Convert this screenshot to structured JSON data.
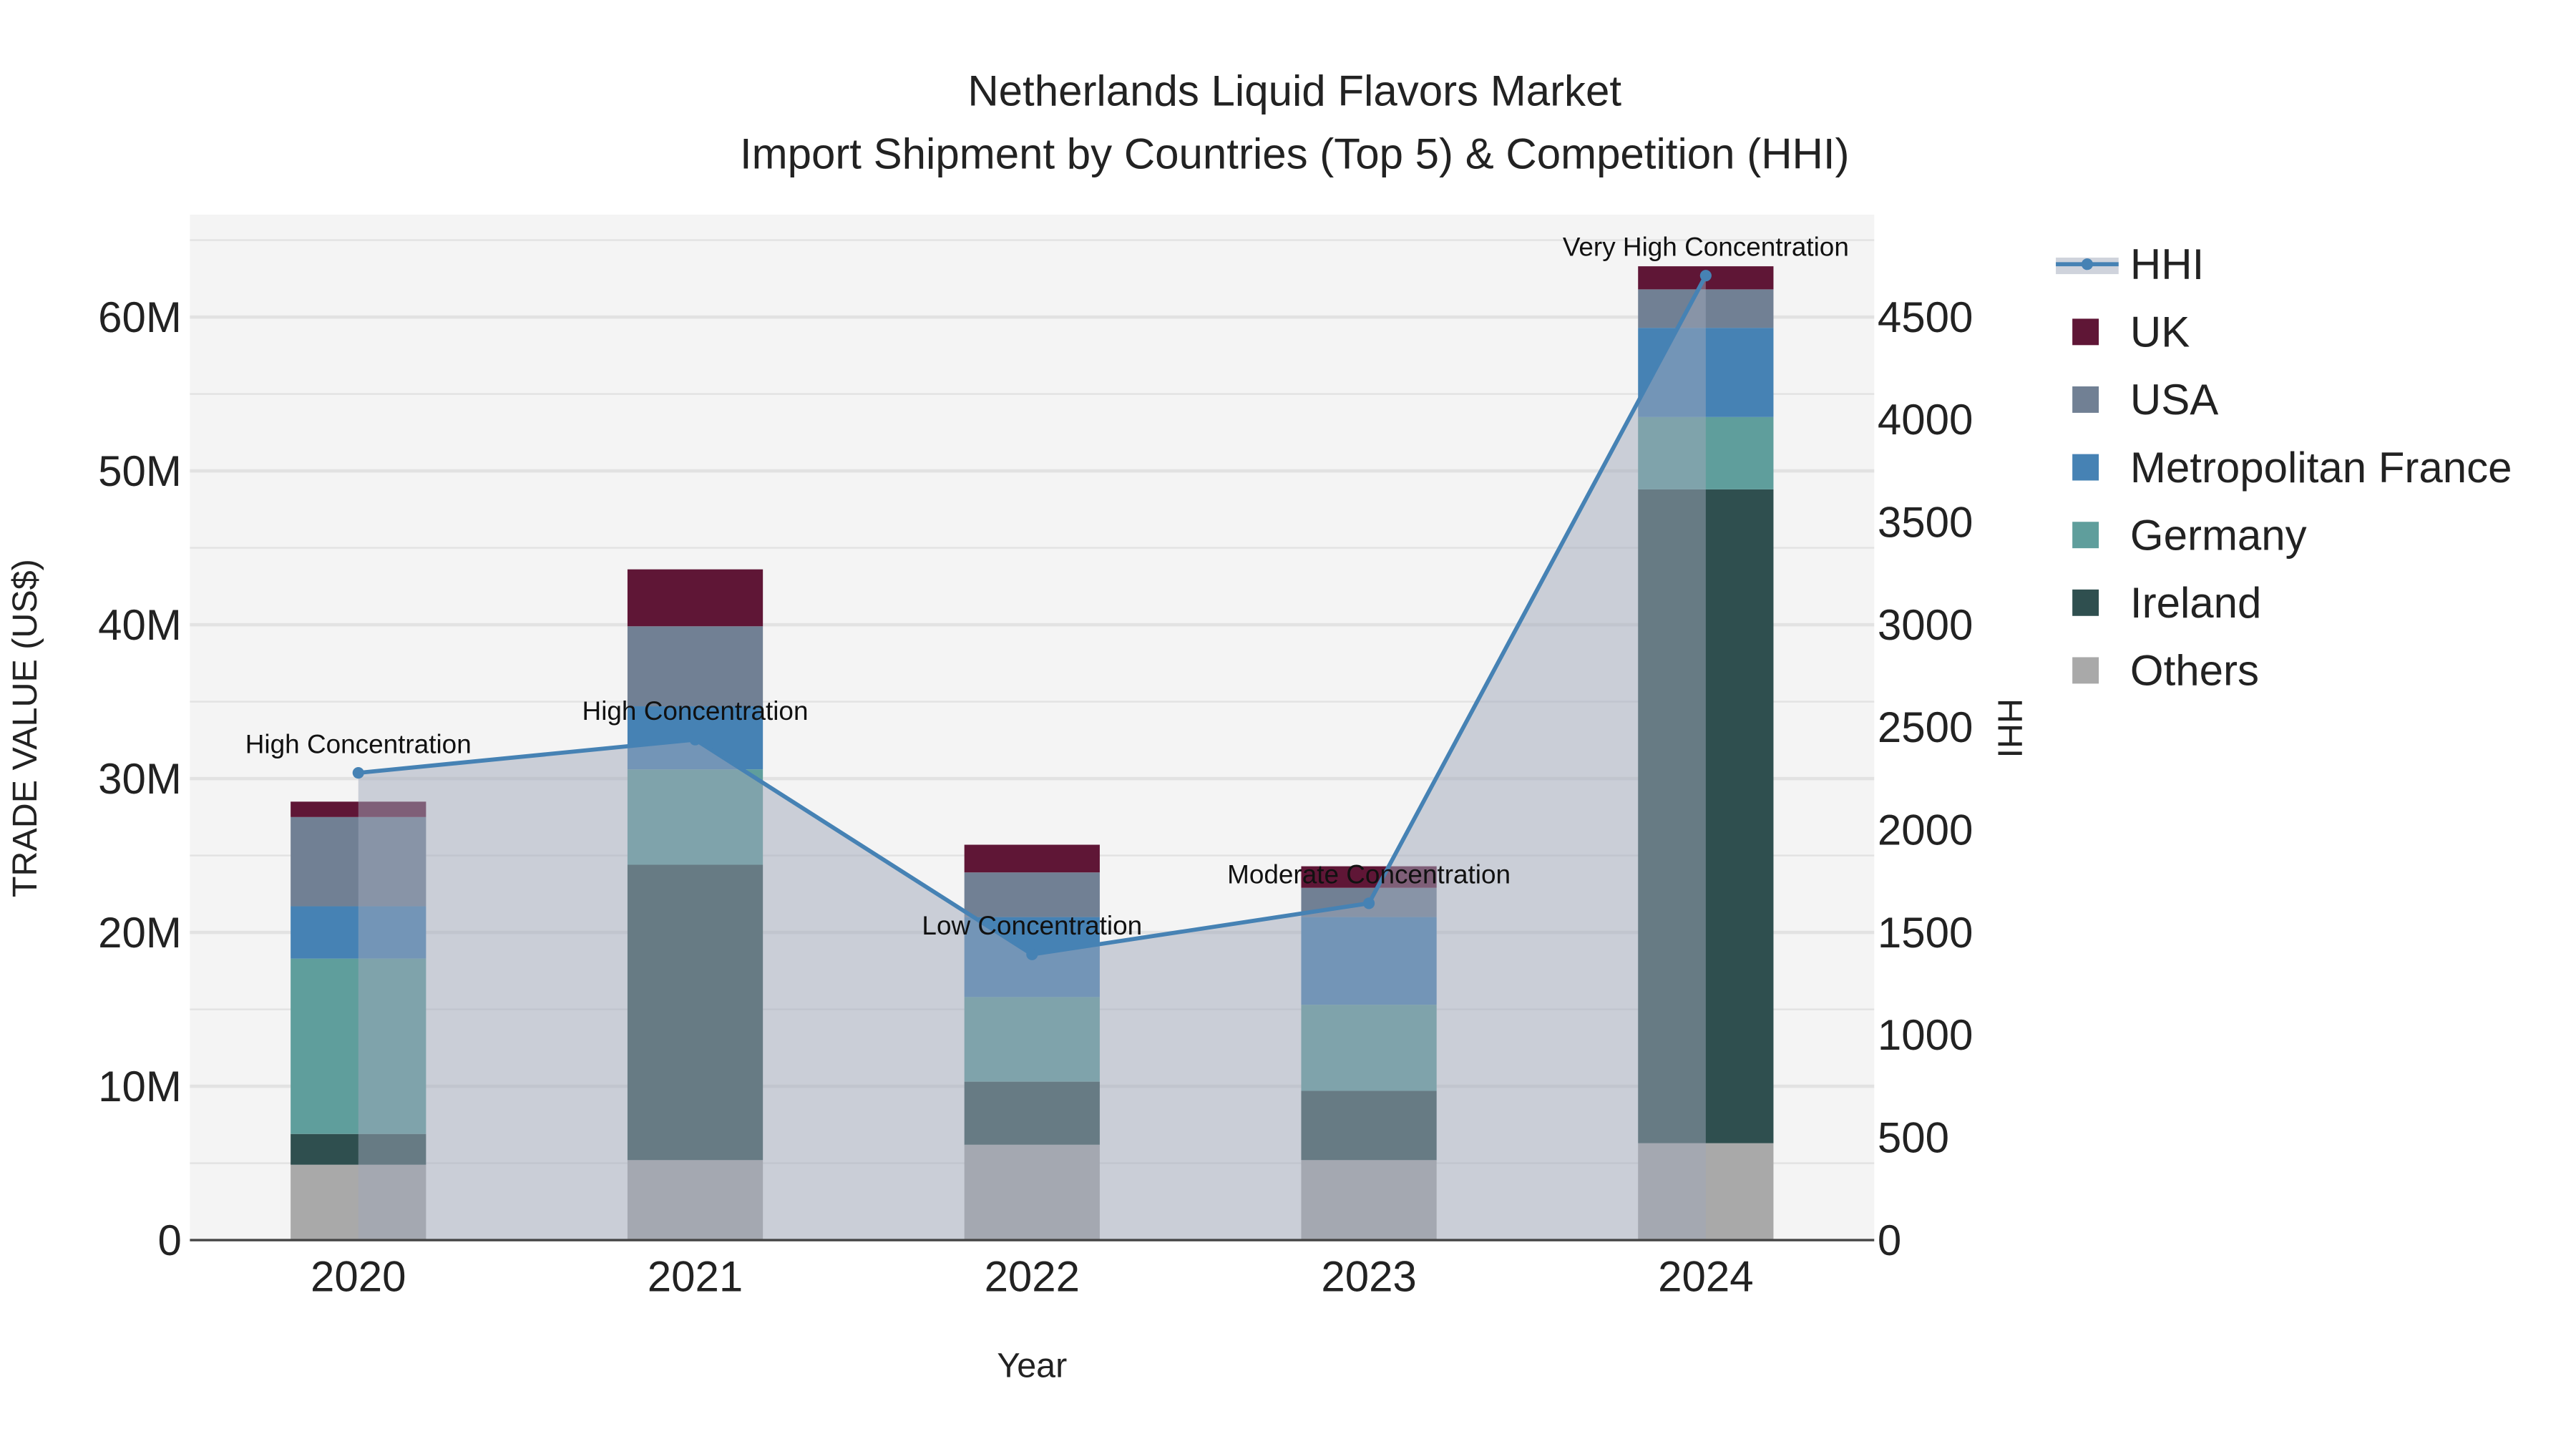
{
  "chart_data": {
    "type": "bar",
    "stacked": true,
    "title": "Netherlands Liquid Flavors Market",
    "subtitle": "Import Shipment by Countries (Top 5) & Competition (HHI)",
    "xlabel": "Year",
    "ylabel": "TRADE VALUE (US$)",
    "y2label": "HHI",
    "categories": [
      "2020",
      "2021",
      "2022",
      "2023",
      "2024"
    ],
    "ylim": [
      0,
      66
    ],
    "y_unit": "M",
    "yticks": [
      0,
      10,
      20,
      30,
      40,
      50,
      60
    ],
    "ytick_labels": [
      "0",
      "10M",
      "20M",
      "30M",
      "40M",
      "50M",
      "60M"
    ],
    "y2lim": [
      0,
      4970
    ],
    "y2ticks": [
      "0",
      "500",
      "1000",
      "1500",
      "2000",
      "2500",
      "3000",
      "3500",
      "4000",
      "4500"
    ],
    "series": [
      {
        "name": "Others",
        "color": "#a9a9a9",
        "values": [
          4.9,
          5.2,
          6.2,
          5.2,
          6.3
        ]
      },
      {
        "name": "Ireland",
        "color": "#2f4f4f",
        "values": [
          2.0,
          19.2,
          4.1,
          4.5,
          42.5
        ]
      },
      {
        "name": "Germany",
        "color": "#5f9e9c",
        "values": [
          11.4,
          6.2,
          5.5,
          5.6,
          4.7
        ]
      },
      {
        "name": "Metropolitan France",
        "color": "#4682b4",
        "values": [
          3.4,
          4.1,
          5.2,
          5.7,
          5.8
        ]
      },
      {
        "name": "USA",
        "color": "#718094",
        "values": [
          5.8,
          5.2,
          2.9,
          1.9,
          2.5
        ]
      },
      {
        "name": "UK",
        "color": "#5f1636",
        "values": [
          1.0,
          3.7,
          1.8,
          1.4,
          1.5
        ]
      }
    ],
    "hhi": {
      "name": "HHI",
      "color": "#4682b4",
      "values": [
        2278,
        2440,
        1393,
        1642,
        4702
      ],
      "annotations": [
        "High Concentration",
        "High Concentration",
        "Low Concentration",
        "Moderate Concentration",
        "Very High Concentration"
      ]
    },
    "legend": [
      "HHI",
      "UK",
      "USA",
      "Metropolitan France",
      "Germany",
      "Ireland",
      "Others"
    ],
    "legend_placement": "right",
    "grid": true
  }
}
